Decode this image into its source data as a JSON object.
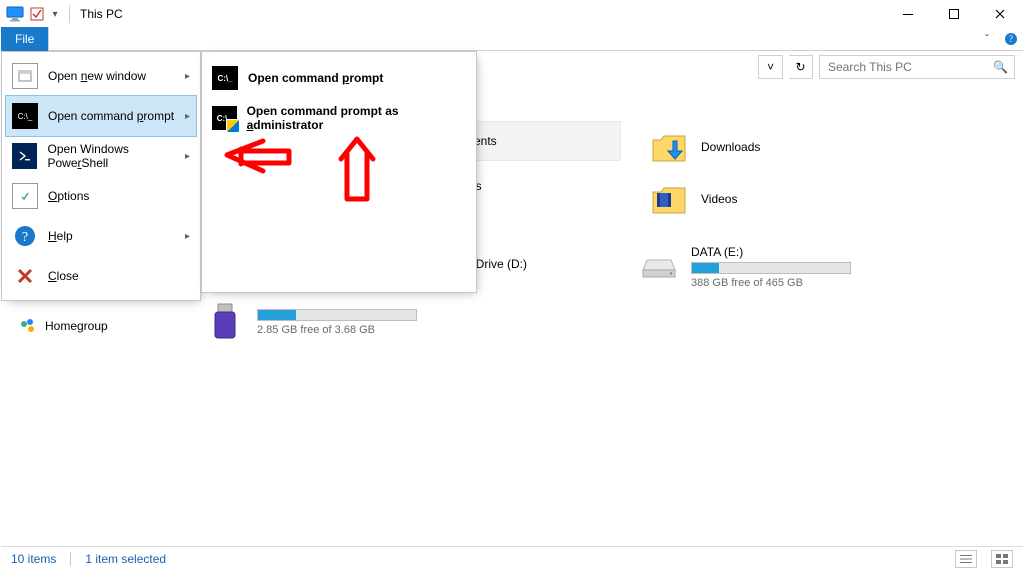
{
  "window": {
    "title": "This PC"
  },
  "tabs": {
    "file": "File"
  },
  "search": {
    "placeholder": "Search This PC"
  },
  "fileMenu": {
    "newWindow": "Open new window",
    "cmdPrompt": "Open command prompt",
    "powerShell": "Open Windows PowerShell",
    "options": "Options",
    "help": "Help",
    "close": "Close",
    "newWindow_u": "n",
    "cmdPrompt_u": "p",
    "powerShell_u": "r",
    "options_u": "O",
    "help_u": "H",
    "close_u": "C"
  },
  "submenu": {
    "open": "Open command prompt",
    "admin": "Open command prompt as administrator",
    "open_u": "p",
    "admin_u": "a"
  },
  "folders": {
    "documents_partial": "ments",
    "downloads": "Downloads",
    "pictures_partial": "es",
    "videos": "Videos"
  },
  "drives": {
    "dvd_partial": "W Drive (D:)",
    "data": {
      "label": "DATA (E:)",
      "sub": "388 GB free of 465 GB",
      "fill_pct": 17
    },
    "usb": {
      "sub": "2.85 GB free of 3.68 GB",
      "fill_pct": 24
    }
  },
  "nav": {
    "homegroup": "Homegroup"
  },
  "status": {
    "items": "10 items",
    "selected": "1 item selected"
  },
  "icons": {
    "back": "←",
    "fwd": "→",
    "up": "↑",
    "dropdown": "˅",
    "refresh": "↻",
    "search": "🔍",
    "chevron": "▸",
    "expand": "ˇ",
    "helpq": "?",
    "close": "✕"
  }
}
